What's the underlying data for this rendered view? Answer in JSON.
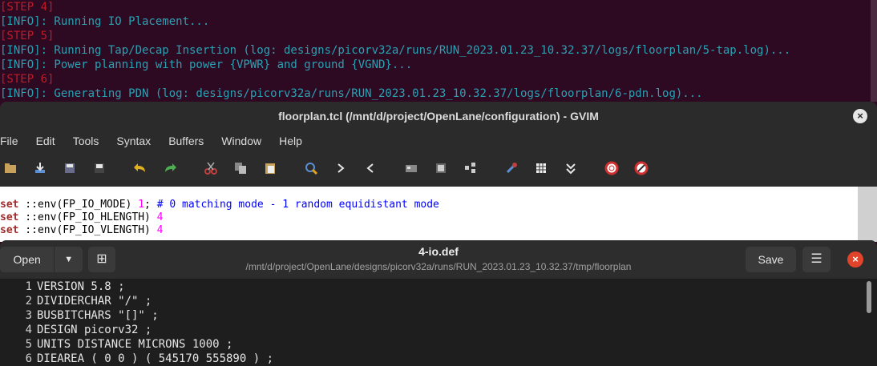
{
  "terminal": {
    "lines": [
      {
        "kind": "step",
        "text": "[STEP 4]"
      },
      {
        "kind": "info",
        "text": "[INFO]: Running IO Placement..."
      },
      {
        "kind": "step",
        "text": "[STEP 5]"
      },
      {
        "kind": "info",
        "text": "[INFO]: Running Tap/Decap Insertion (log: designs/picorv32a/runs/RUN_2023.01.23_10.32.37/logs/floorplan/5-tap.log)..."
      },
      {
        "kind": "info",
        "text": "[INFO]: Power planning with power {VPWR} and ground {VGND}..."
      },
      {
        "kind": "step",
        "text": "[STEP 6]"
      },
      {
        "kind": "info",
        "text": "[INFO]: Generating PDN (log: designs/picorv32a/runs/RUN_2023.01.23_10.32.37/logs/floorplan/6-pdn.log)..."
      }
    ]
  },
  "gvim": {
    "title": "floorplan.tcl (/mnt/d/project/OpenLane/configuration) - GVIM",
    "close": "×",
    "menu": [
      "File",
      "Edit",
      "Tools",
      "Syntax",
      "Buffers",
      "Window",
      "Help"
    ],
    "toolbar_icons": [
      "open-icon",
      "save-icon",
      "save-all-icon",
      "print-icon",
      "undo-icon",
      "redo-icon",
      "cut-icon",
      "copy-icon",
      "paste-icon",
      "find-replace-icon",
      "find-next-icon",
      "find-prev-icon",
      "load-session-icon",
      "save-session-icon",
      "run-script-icon",
      "make-icon",
      "shell-icon",
      "ctags-icon",
      "help-icon",
      "find-help-icon"
    ],
    "lines": [
      {
        "kw": "set",
        "rest": " ::env(FP_IO_MODE) ",
        "num": "1",
        "tail": "; ",
        "comment": "# 0 matching mode - 1 random equidistant mode"
      },
      {
        "kw": "set",
        "rest": " ::env(FP_IO_HLENGTH) ",
        "num": "4",
        "tail": "",
        "comment": ""
      },
      {
        "kw": "set",
        "rest": " ::env(FP_IO_VLENGTH) ",
        "num": "4",
        "tail": "",
        "comment": ""
      }
    ]
  },
  "gedit": {
    "open_label": "Open",
    "dropdown": "▼",
    "new_tab": "⊞",
    "title": "4-io.def",
    "subtitle": "/mnt/d/project/OpenLane/designs/picorv32a/runs/RUN_2023.01.23_10.32.37/tmp/floorplan",
    "save_label": "Save",
    "menu": "☰",
    "close": "×",
    "lines": [
      {
        "n": "1",
        "t": "VERSION 5.8 ;"
      },
      {
        "n": "2",
        "t": "DIVIDERCHAR \"/\" ;"
      },
      {
        "n": "3",
        "t": "BUSBITCHARS \"[]\" ;"
      },
      {
        "n": "4",
        "t": "DESIGN picorv32 ;"
      },
      {
        "n": "5",
        "t": "UNITS DISTANCE MICRONS 1000 ;"
      },
      {
        "n": "6",
        "t": "DIEAREA ( 0 0 ) ( 545170 555890 ) ;"
      }
    ]
  }
}
